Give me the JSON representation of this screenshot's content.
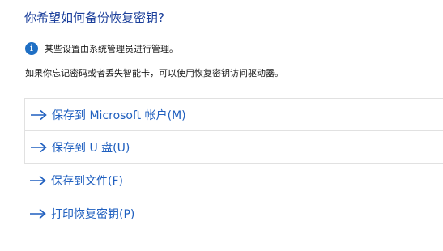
{
  "title": "你希望如何备份恢复密钥?",
  "info": {
    "icon": "info-icon",
    "text": "某些设置由系统管理员进行管理。"
  },
  "description": "如果你忘记密码或者丢失智能卡，可以使用恢复密钥访问驱动器。",
  "options": [
    {
      "label": "保存到 Microsoft 帐户(M)",
      "icon": "arrow-right-icon"
    },
    {
      "label": "保存到 U 盘(U)",
      "icon": "arrow-right-icon"
    },
    {
      "label": "保存到文件(F)",
      "icon": "arrow-right-icon"
    },
    {
      "label": "打印恢复密钥(P)",
      "icon": "arrow-right-icon"
    }
  ],
  "colors": {
    "title": "#1a3e9a",
    "link": "#1f5fbf",
    "info_icon": "#1f6fc4",
    "border": "#e1e1e1"
  }
}
